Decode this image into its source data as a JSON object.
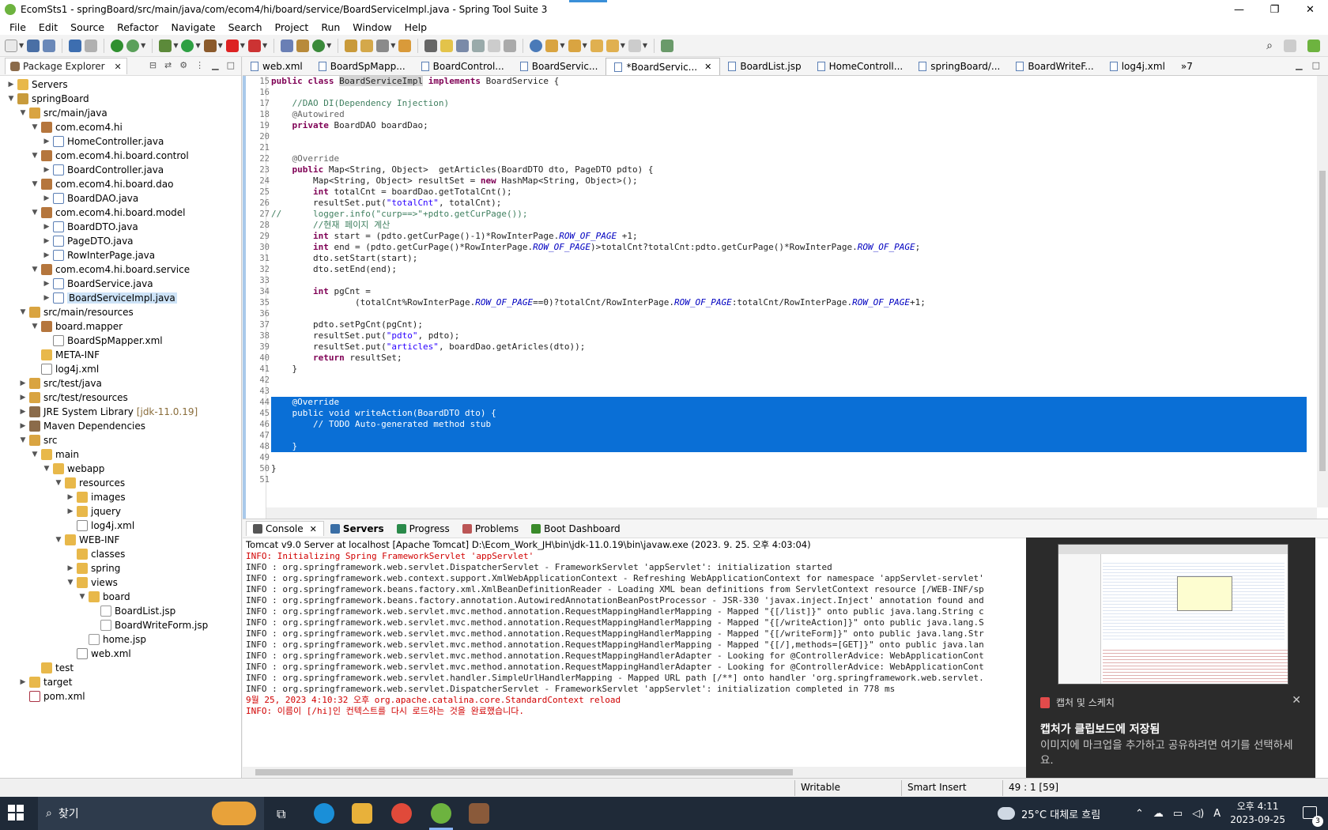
{
  "window": {
    "title": "EcomSts1 - springBoard/src/main/java/com/ecom4/hi/board/service/BoardServiceImpl.java - Spring Tool Suite 3",
    "controls": [
      "—",
      "❐",
      "✕"
    ]
  },
  "menu": [
    "File",
    "Edit",
    "Source",
    "Refactor",
    "Navigate",
    "Search",
    "Project",
    "Run",
    "Window",
    "Help"
  ],
  "package_explorer": {
    "tab_label": "Package Explorer",
    "tree": [
      {
        "depth": 0,
        "arrow": "▶",
        "icon": "folder",
        "label": "Servers"
      },
      {
        "depth": 0,
        "arrow": "▼",
        "icon": "project",
        "label": "springBoard"
      },
      {
        "depth": 1,
        "arrow": "▼",
        "icon": "srcfolder",
        "label": "src/main/java"
      },
      {
        "depth": 2,
        "arrow": "▼",
        "icon": "package",
        "label": "com.ecom4.hi"
      },
      {
        "depth": 3,
        "arrow": "▶",
        "icon": "java",
        "label": "HomeController.java"
      },
      {
        "depth": 2,
        "arrow": "▼",
        "icon": "package",
        "label": "com.ecom4.hi.board.control"
      },
      {
        "depth": 3,
        "arrow": "▶",
        "icon": "java",
        "label": "BoardController.java"
      },
      {
        "depth": 2,
        "arrow": "▼",
        "icon": "package",
        "label": "com.ecom4.hi.board.dao"
      },
      {
        "depth": 3,
        "arrow": "▶",
        "icon": "java",
        "label": "BoardDAO.java"
      },
      {
        "depth": 2,
        "arrow": "▼",
        "icon": "package",
        "label": "com.ecom4.hi.board.model"
      },
      {
        "depth": 3,
        "arrow": "▶",
        "icon": "java",
        "label": "BoardDTO.java"
      },
      {
        "depth": 3,
        "arrow": "▶",
        "icon": "java",
        "label": "PageDTO.java"
      },
      {
        "depth": 3,
        "arrow": "▶",
        "icon": "java",
        "label": "RowInterPage.java"
      },
      {
        "depth": 2,
        "arrow": "▼",
        "icon": "package",
        "label": "com.ecom4.hi.board.service"
      },
      {
        "depth": 3,
        "arrow": "▶",
        "icon": "java",
        "label": "BoardService.java"
      },
      {
        "depth": 3,
        "arrow": "▶",
        "icon": "java",
        "label": "BoardServiceImpl.java",
        "selected": true
      },
      {
        "depth": 1,
        "arrow": "▼",
        "icon": "srcfolder",
        "label": "src/main/resources"
      },
      {
        "depth": 2,
        "arrow": "▼",
        "icon": "package",
        "label": "board.mapper"
      },
      {
        "depth": 3,
        "arrow": "",
        "icon": "xml",
        "label": "BoardSpMapper.xml"
      },
      {
        "depth": 2,
        "arrow": "",
        "icon": "folder",
        "label": "META-INF"
      },
      {
        "depth": 2,
        "arrow": "",
        "icon": "xml",
        "label": "log4j.xml"
      },
      {
        "depth": 1,
        "arrow": "▶",
        "icon": "srcfolder",
        "label": "src/test/java"
      },
      {
        "depth": 1,
        "arrow": "▶",
        "icon": "srcfolder",
        "label": "src/test/resources"
      },
      {
        "depth": 1,
        "arrow": "▶",
        "icon": "lib",
        "label": "JRE System Library",
        "suffix": "[jdk-11.0.19]"
      },
      {
        "depth": 1,
        "arrow": "▶",
        "icon": "lib",
        "label": "Maven Dependencies"
      },
      {
        "depth": 1,
        "arrow": "▼",
        "icon": "srcfolder",
        "label": "src"
      },
      {
        "depth": 2,
        "arrow": "▼",
        "icon": "folder",
        "label": "main"
      },
      {
        "depth": 3,
        "arrow": "▼",
        "icon": "folder",
        "label": "webapp"
      },
      {
        "depth": 4,
        "arrow": "▼",
        "icon": "folder",
        "label": "resources"
      },
      {
        "depth": 5,
        "arrow": "▶",
        "icon": "folder",
        "label": "images"
      },
      {
        "depth": 5,
        "arrow": "▶",
        "icon": "folder",
        "label": "jquery"
      },
      {
        "depth": 5,
        "arrow": "",
        "icon": "xml",
        "label": "log4j.xml"
      },
      {
        "depth": 4,
        "arrow": "▼",
        "icon": "folder",
        "label": "WEB-INF"
      },
      {
        "depth": 5,
        "arrow": "",
        "icon": "folder",
        "label": "classes"
      },
      {
        "depth": 5,
        "arrow": "▶",
        "icon": "folder",
        "label": "spring"
      },
      {
        "depth": 5,
        "arrow": "▼",
        "icon": "folder",
        "label": "views"
      },
      {
        "depth": 6,
        "arrow": "▼",
        "icon": "folder",
        "label": "board"
      },
      {
        "depth": 7,
        "arrow": "",
        "icon": "jsp",
        "label": "BoardList.jsp"
      },
      {
        "depth": 7,
        "arrow": "",
        "icon": "jsp",
        "label": "BoardWriteForm.jsp"
      },
      {
        "depth": 6,
        "arrow": "",
        "icon": "jsp",
        "label": "home.jsp"
      },
      {
        "depth": 5,
        "arrow": "",
        "icon": "xml",
        "label": "web.xml"
      },
      {
        "depth": 2,
        "arrow": "",
        "icon": "folder",
        "label": "test"
      },
      {
        "depth": 1,
        "arrow": "▶",
        "icon": "folder",
        "label": "target"
      },
      {
        "depth": 1,
        "arrow": "",
        "icon": "pom",
        "label": "pom.xml"
      }
    ]
  },
  "editor_tabs": [
    {
      "label": "web.xml"
    },
    {
      "label": "BoardSpMapp..."
    },
    {
      "label": "BoardControl..."
    },
    {
      "label": "BoardServic..."
    },
    {
      "label": "*BoardServic...",
      "active": true
    },
    {
      "label": "BoardList.jsp"
    },
    {
      "label": "HomeControll..."
    },
    {
      "label": "springBoard/..."
    },
    {
      "label": "BoardWriteF..."
    },
    {
      "label": "log4j.xml"
    },
    {
      "label": "»7"
    }
  ],
  "code_lines": [
    {
      "n": "15",
      "t": "public class BoardServiceImpl implements BoardService {"
    },
    {
      "n": "16",
      "t": ""
    },
    {
      "n": "17",
      "t": "    //DAO DI(Dependency Injection)"
    },
    {
      "n": "18",
      "t": "    @Autowired"
    },
    {
      "n": "19",
      "t": "    private BoardDAO boardDao;"
    },
    {
      "n": "20",
      "t": ""
    },
    {
      "n": "21",
      "t": ""
    },
    {
      "n": "22",
      "t": "    @Override"
    },
    {
      "n": "23",
      "t": "    public Map<String, Object>  getArticles(BoardDTO dto, PageDTO pdto) {"
    },
    {
      "n": "24",
      "t": "        Map<String, Object> resultSet = new HashMap<String, Object>();"
    },
    {
      "n": "25",
      "t": "        int totalCnt = boardDao.getTotalCnt();"
    },
    {
      "n": "26",
      "t": "        resultSet.put(\"totalCnt\", totalCnt);"
    },
    {
      "n": "27",
      "t": "//      logger.info(\"curp==>\"+pdto.getCurPage());"
    },
    {
      "n": "28",
      "t": "        //현재 페이지 계산"
    },
    {
      "n": "29",
      "t": "        int start = (pdto.getCurPage()-1)*RowInterPage.ROW_OF_PAGE +1;"
    },
    {
      "n": "30",
      "t": "        int end = (pdto.getCurPage()*RowInterPage.ROW_OF_PAGE)>totalCnt?totalCnt:pdto.getCurPage()*RowInterPage.ROW_OF_PAGE;"
    },
    {
      "n": "31",
      "t": "        dto.setStart(start);"
    },
    {
      "n": "32",
      "t": "        dto.setEnd(end);"
    },
    {
      "n": "33",
      "t": ""
    },
    {
      "n": "34",
      "t": "        int pgCnt ="
    },
    {
      "n": "35",
      "t": "                (totalCnt%RowInterPage.ROW_OF_PAGE==0)?totalCnt/RowInterPage.ROW_OF_PAGE:totalCnt/RowInterPage.ROW_OF_PAGE+1;"
    },
    {
      "n": "36",
      "t": ""
    },
    {
      "n": "37",
      "t": "        pdto.setPgCnt(pgCnt);"
    },
    {
      "n": "38",
      "t": "        resultSet.put(\"pdto\", pdto);"
    },
    {
      "n": "39",
      "t": "        resultSet.put(\"articles\", boardDao.getAricles(dto));"
    },
    {
      "n": "40",
      "t": "        return resultSet;"
    },
    {
      "n": "41",
      "t": "    }"
    },
    {
      "n": "42",
      "t": ""
    },
    {
      "n": "43",
      "t": ""
    },
    {
      "n": "44",
      "t": "    @Override",
      "sel": true
    },
    {
      "n": "45",
      "t": "    public void writeAction(BoardDTO dto) {",
      "sel": true
    },
    {
      "n": "46",
      "t": "        // TODO Auto-generated method stub",
      "sel": true
    },
    {
      "n": "47",
      "t": "",
      "sel": true
    },
    {
      "n": "48",
      "t": "    }",
      "sel": true
    },
    {
      "n": "49",
      "t": ""
    },
    {
      "n": "50",
      "t": "}"
    },
    {
      "n": "51",
      "t": ""
    }
  ],
  "bottom_tabs": [
    {
      "label": "Console",
      "icon": "console-icon",
      "active": true
    },
    {
      "label": "Servers",
      "icon": "servers-icon"
    },
    {
      "label": "Progress",
      "icon": "progress-icon"
    },
    {
      "label": "Problems",
      "icon": "problems-icon"
    },
    {
      "label": "Boot Dashboard",
      "icon": "boot-dashboard-icon"
    }
  ],
  "console": {
    "title": "Tomcat v9.0 Server at localhost [Apache Tomcat] D:\\Ecom_Work_JH\\bin\\jdk-11.0.19\\bin\\javaw.exe  (2023. 9. 25. 오후 4:03:04)",
    "lines": [
      {
        "t": "INFO: Initializing Spring FrameworkServlet 'appServlet'",
        "red": true
      },
      {
        "t": "INFO : org.springframework.web.servlet.DispatcherServlet - FrameworkServlet 'appServlet': initialization started"
      },
      {
        "t": "INFO : org.springframework.web.context.support.XmlWebApplicationContext - Refreshing WebApplicationContext for namespace 'appServlet-servlet'"
      },
      {
        "t": "INFO : org.springframework.beans.factory.xml.XmlBeanDefinitionReader - Loading XML bean definitions from ServletContext resource [/WEB-INF/sp"
      },
      {
        "t": "INFO : org.springframework.beans.factory.annotation.AutowiredAnnotationBeanPostProcessor - JSR-330 'javax.inject.Inject' annotation found and"
      },
      {
        "t": "INFO : org.springframework.web.servlet.mvc.method.annotation.RequestMappingHandlerMapping - Mapped \"{[/list]}\" onto public java.lang.String c"
      },
      {
        "t": "INFO : org.springframework.web.servlet.mvc.method.annotation.RequestMappingHandlerMapping - Mapped \"{[/writeAction]}\" onto public java.lang.S"
      },
      {
        "t": "INFO : org.springframework.web.servlet.mvc.method.annotation.RequestMappingHandlerMapping - Mapped \"{[/writeForm]}\" onto public java.lang.Str"
      },
      {
        "t": "INFO : org.springframework.web.servlet.mvc.method.annotation.RequestMappingHandlerMapping - Mapped \"{[/],methods=[GET]}\" onto public java.lan"
      },
      {
        "t": "INFO : org.springframework.web.servlet.mvc.method.annotation.RequestMappingHandlerAdapter - Looking for @ControllerAdvice: WebApplicationCont"
      },
      {
        "t": "INFO : org.springframework.web.servlet.mvc.method.annotation.RequestMappingHandlerAdapter - Looking for @ControllerAdvice: WebApplicationCont"
      },
      {
        "t": "INFO : org.springframework.web.servlet.handler.SimpleUrlHandlerMapping - Mapped URL path [/**] onto handler 'org.springframework.web.servlet."
      },
      {
        "t": "INFO : org.springframework.web.servlet.DispatcherServlet - FrameworkServlet 'appServlet': initialization completed in 778 ms"
      },
      {
        "t": "9월 25, 2023 4:10:32 오후 org.apache.catalina.core.StandardContext reload",
        "red": true
      },
      {
        "t": "INFO: 이름이 [/hi]인 컨텍스트를 다시 로드하는 것을 완료했습니다.",
        "red": true
      }
    ]
  },
  "status": {
    "writable": "Writable",
    "insert_mode": "Smart Insert",
    "position": "49 : 1 [59]"
  },
  "toast": {
    "app_name": "캡처 및 스케치",
    "title": "캡처가 클립보드에 저장됨",
    "body": "이미지에 마크업을 추가하고 공유하려면 여기를 선택하세요."
  },
  "taskbar": {
    "search_placeholder": "찾기",
    "weather": "25°C 대체로 흐림",
    "ime": "A",
    "time": "오후 4:11",
    "date": "2023-09-25",
    "notification_count": "3"
  },
  "colors": {
    "selection": "#0a6fd6",
    "keyword": "#7f0055",
    "comment": "#3f7f5f",
    "string": "#2a00ff",
    "field": "#0000c0"
  }
}
